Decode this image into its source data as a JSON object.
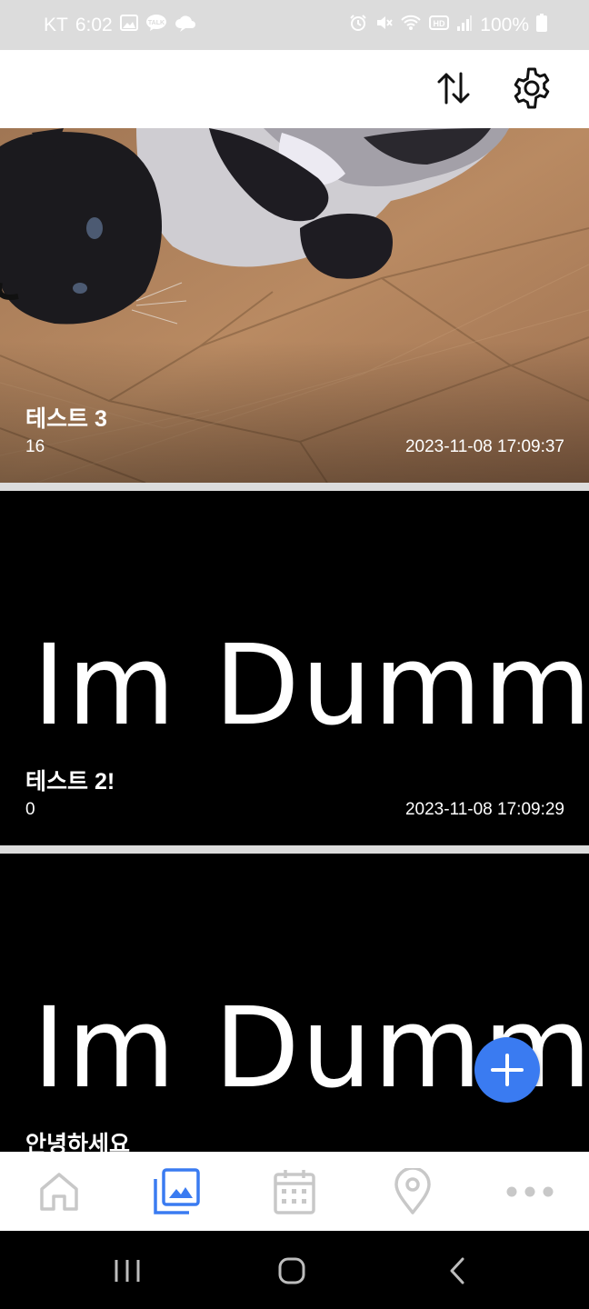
{
  "status_bar": {
    "carrier": "KT",
    "time": "6:02",
    "battery": "100%",
    "icons_left": [
      "gallery-icon",
      "kakaotalk-icon",
      "cloud-chat-icon"
    ],
    "icons_right": [
      "alarm-icon",
      "mute-icon",
      "wifi-icon",
      "hd-icon",
      "signal-icon",
      "battery-icon"
    ]
  },
  "appbar": {
    "sort_icon": "sort-icon",
    "settings_icon": "gear-icon"
  },
  "cards": [
    {
      "title": "테스트 3",
      "count": "16",
      "date": "2023-11-08 17:09:37",
      "image": "cat-photo"
    },
    {
      "title": "테스트 2!",
      "count": "0",
      "date": "2023-11-08 17:09:29",
      "image_text": "Im Dummy"
    },
    {
      "title": "안녕하세요",
      "image_text": "Im Dummy"
    }
  ],
  "fab": {
    "icon": "plus-icon",
    "color": "#3a7bf1"
  },
  "bottom_nav": {
    "items": [
      {
        "icon": "home-icon",
        "active": false
      },
      {
        "icon": "gallery-icon",
        "active": true
      },
      {
        "icon": "calendar-icon",
        "active": false
      },
      {
        "icon": "location-pin-icon",
        "active": false
      },
      {
        "icon": "more-icon",
        "active": false
      }
    ],
    "active_color": "#3a7bf1",
    "inactive_color": "#c8c8c8"
  },
  "system_nav": [
    "recents-icon",
    "home-button-icon",
    "back-icon"
  ]
}
